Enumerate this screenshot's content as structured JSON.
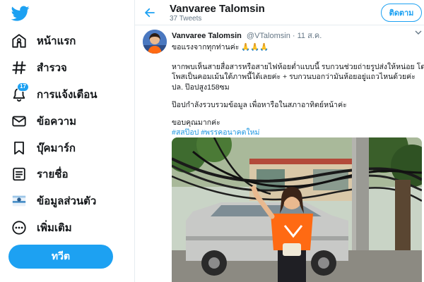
{
  "sidebar": {
    "items": [
      {
        "label": "หน้าแรก",
        "icon": "home-icon"
      },
      {
        "label": "สำรวจ",
        "icon": "hashtag-icon"
      },
      {
        "label": "การแจ้งเตือน",
        "icon": "bell-icon",
        "badge": "17"
      },
      {
        "label": "ข้อความ",
        "icon": "envelope-icon"
      },
      {
        "label": "บุ๊คมาร์ก",
        "icon": "bookmark-icon"
      },
      {
        "label": "รายชื่อ",
        "icon": "list-icon"
      },
      {
        "label": "ข้อมูลส่วนตัว",
        "icon": "profile-icon"
      },
      {
        "label": "เพิ่มเติม",
        "icon": "more-icon"
      }
    ],
    "tweet_button": "ทวีต"
  },
  "header": {
    "name": "Vanvaree Talomsin",
    "tweet_count": "37 Tweets",
    "follow_label": "ติดตาม"
  },
  "tweet": {
    "author_name": "Vanvaree Talomsin",
    "handle": "@VTalomsin · 11 ส.ค.",
    "lines": [
      "ขอแรงจากทุกท่านค่ะ 🙏🙏🙏",
      "หากพบเห็นสายสื่อสารหรือสายไฟห้อยต่ำแบบนี้ รบกวนช่วยถ่ายรูปส่งให้หน่อย โดย",
      "โพสเป็นคอมเม้นใต้ภาพนี้ได้เลยค่ะ + รบกวนบอกว่ามันห้อยอยู่แถวไหนด้วยค่ะ",
      "ปล. ป๊อปสูง158ซม",
      "ป๊อปกำลังรวบรวมข้อมูล เพื่อหารือในสภาอาทิตย์หน้าค่ะ",
      "ขอบคุณมากค่ะ"
    ],
    "hashtags": [
      "#สสป๊อป",
      "#พรรคอนาคตใหม่"
    ]
  },
  "colors": {
    "accent": "#1da1f2",
    "link": "#1b95e0",
    "text": "#14171a",
    "secondary": "#657786",
    "orange": "#ff6a13"
  }
}
